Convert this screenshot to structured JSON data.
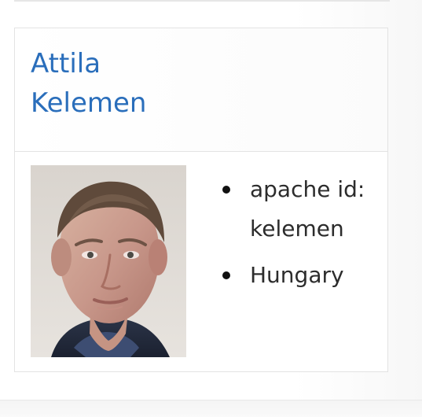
{
  "member": {
    "name": "Attila Kelemen",
    "photo_icon": "profile-photo",
    "details": [
      "apache id: kelemen",
      "Hungary"
    ]
  }
}
